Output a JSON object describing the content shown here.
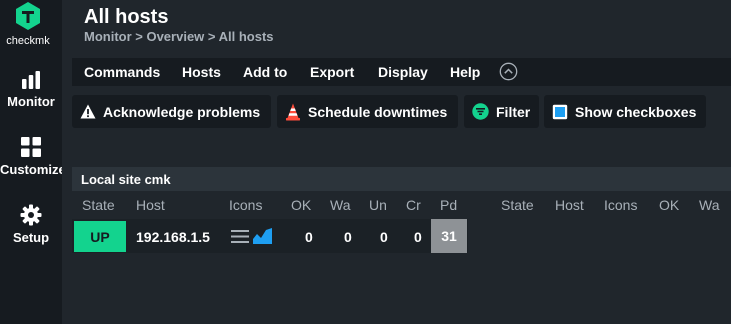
{
  "app": {
    "logo_text": "checkmk"
  },
  "sidebar": {
    "items": [
      {
        "label": "Monitor",
        "icon": "monitor-bars-icon"
      },
      {
        "label": "Customize",
        "icon": "customize-grid-icon"
      },
      {
        "label": "Setup",
        "icon": "setup-gear-icon"
      }
    ]
  },
  "page": {
    "title": "All hosts",
    "breadcrumb": "Monitor > Overview > All hosts"
  },
  "menu": {
    "items": [
      "Commands",
      "Hosts",
      "Add to",
      "Export",
      "Display",
      "Help"
    ],
    "toggle_icon": "chevron-up-circle-icon"
  },
  "toolbar": {
    "acknowledge_label": "Acknowledge problems",
    "schedule_label": "Schedule downtimes",
    "filter_label": "Filter",
    "checkboxes_label": "Show checkboxes"
  },
  "site": {
    "header": "Local site cmk"
  },
  "table": {
    "columns": [
      "State",
      "Host",
      "Icons",
      "OK",
      "Wa",
      "Un",
      "Cr",
      "Pd"
    ],
    "columns_repeat": [
      "State",
      "Host",
      "Icons",
      "OK",
      "Wa"
    ],
    "rows": [
      {
        "state": "UP",
        "host": "192.168.1.5",
        "ok": "0",
        "wa": "0",
        "un": "0",
        "cr": "0",
        "pd": "31"
      }
    ]
  },
  "colors": {
    "accent_green": "#13d38e",
    "background": "#20262c",
    "sidebar_bg": "#161b20",
    "pending_gray": "#8e9296"
  }
}
